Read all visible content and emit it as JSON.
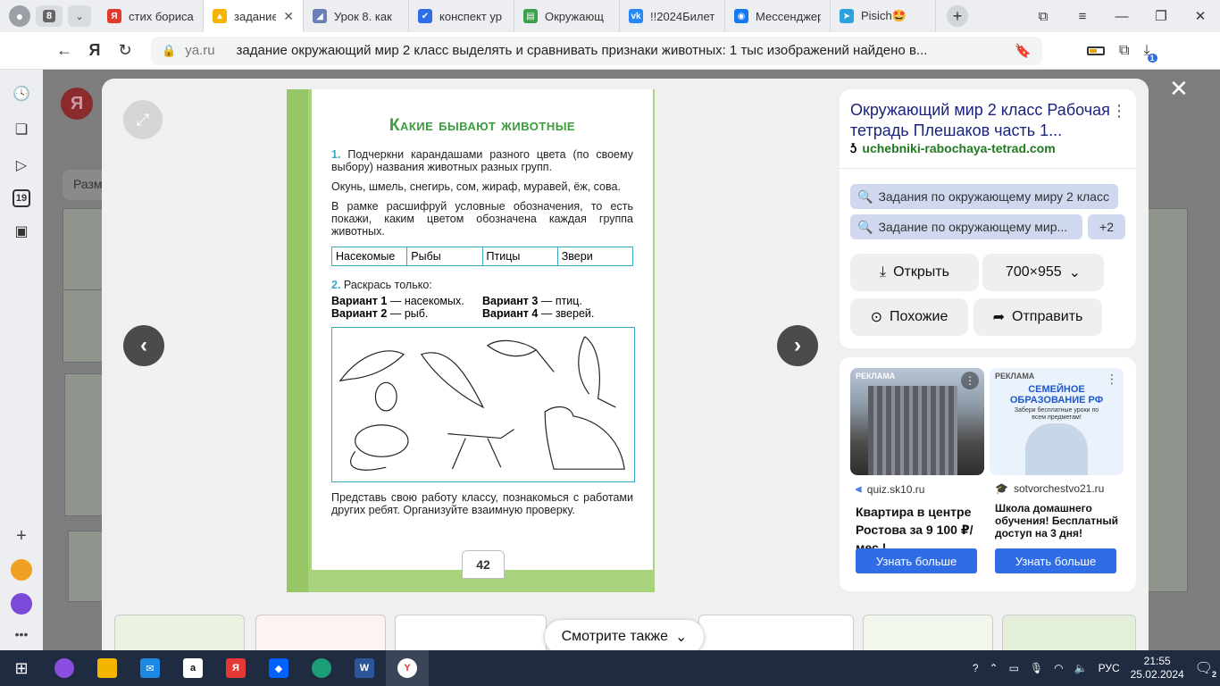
{
  "browser": {
    "tab_count": "8",
    "tabs": [
      {
        "label": "стих бориса",
        "favicon_color": "#e23b2e",
        "favicon_glyph": "Я"
      },
      {
        "label": "задание о",
        "favicon_color": "#f5b400",
        "favicon_glyph": "▲",
        "active": true
      },
      {
        "label": "Урок 8. как",
        "favicon_color": "#6a7fb5",
        "favicon_glyph": "◢"
      },
      {
        "label": "конспект ур",
        "favicon_color": "#2f6ce5",
        "favicon_glyph": "✔"
      },
      {
        "label": "Окружающ",
        "favicon_color": "#3da14a",
        "favicon_glyph": "▤"
      },
      {
        "label": "!!2024Билет",
        "favicon_color": "#2787f5",
        "favicon_glyph": "vk"
      },
      {
        "label": "Мессенджер",
        "favicon_color": "#1877f2",
        "favicon_glyph": "◉"
      },
      {
        "label": "Pisich🤩",
        "favicon_color": "#2aa3df",
        "favicon_glyph": "➤"
      }
    ],
    "address": {
      "domain": "ya.ru",
      "query": "задание окружающий мир 2 класс выделять и сравнивать признаки животных: 1 тыс изображений найдено в..."
    },
    "downloads_badge": "1"
  },
  "background_page": {
    "logo": "Я",
    "chip": "Разм"
  },
  "viewer": {
    "close_label": "✕",
    "book_page": {
      "title": "Какие бывают животные",
      "task1_num": "1.",
      "task1_text": "Подчеркни карандашами разного цвета (по своему выбору) названия животных разных групп.",
      "animals_list": "Окунь, шмель, снегирь, сом, жираф, муравей, ёж, сова.",
      "frame_text": "В рамке расшифруй условные обозначения, то есть покажи, каким цветом обозначена каждая группа животных.",
      "table_headers": [
        "Насекомые",
        "Рыбы",
        "Птицы",
        "Звери"
      ],
      "task2_num": "2.",
      "task2_text": "Раскрась только:",
      "variants": [
        {
          "label": "Вариант 1",
          "text": "— насекомых."
        },
        {
          "label": "Вариант 3",
          "text": "— птиц."
        },
        {
          "label": "Вариант 2",
          "text": "— рыб."
        },
        {
          "label": "Вариант 4",
          "text": "— зверей."
        }
      ],
      "closing_text": "Представь свою работу классу, познакомься с работами других ребят. Организуйте взаимную проверку.",
      "page_number": "42"
    },
    "info": {
      "title": "Окружающий мир 2 класс Рабочая тетрадь Плешаков часть 1...",
      "source": "uchebniki-rabochaya-tetrad.com",
      "chips": [
        "Задания по окружающему миру 2 класс",
        "Задание по окружающему мир...",
        "+2"
      ],
      "open_label": "Открыть",
      "size_label": "700×955",
      "similar_label": "Похожие",
      "share_label": "Отправить"
    },
    "ads": [
      {
        "tag": "РЕКЛАМА",
        "domain": "quiz.sk10.ru",
        "headline": "Квартира в центре Ростова за 9 100 ₽/мес !",
        "cta": "Узнать больше"
      },
      {
        "tag": "РЕКЛАМА",
        "image_title": "СЕМЕЙНОЕ ОБРАЗОВАНИЕ РФ",
        "image_sub": "Забери бесплатные уроки по всем предметам!",
        "domain": "sotvorchestvo21.ru",
        "headline": "Школа домашнего обучения! Бесплатный доступ на 3 дня!",
        "cta": "Узнать больше"
      }
    ],
    "see_also": "Смотрите также"
  },
  "taskbar": {
    "lang": "РУС",
    "time": "21:55",
    "date": "25.02.2024",
    "notifications": "2"
  }
}
